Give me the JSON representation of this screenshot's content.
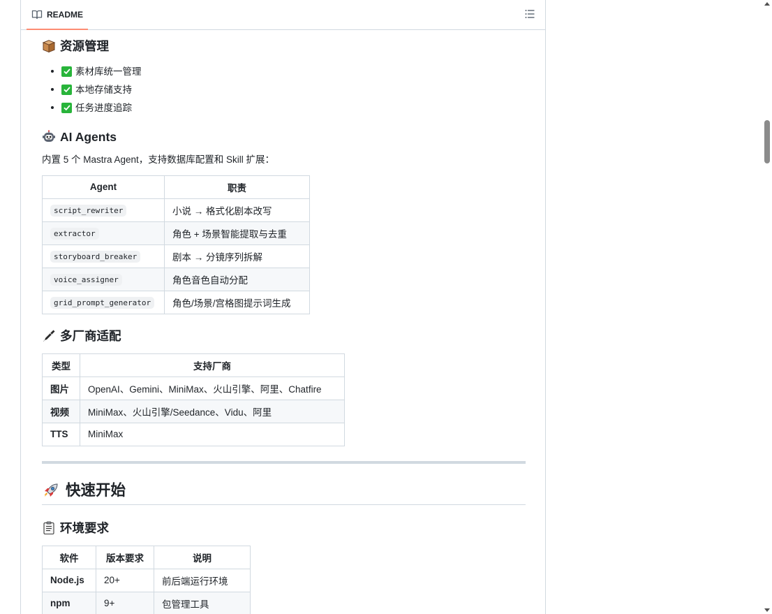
{
  "readme_tab": {
    "label": "README",
    "icon": "book-icon"
  },
  "outline_button": {
    "icon": "list-unordered-icon"
  },
  "resource_section": {
    "emoji": "package-emoji",
    "title": "资源管理",
    "items": [
      "素材库统一管理",
      "本地存储支持",
      "任务进度追踪"
    ]
  },
  "agents_section": {
    "emoji": "robot-emoji",
    "title": "AI Agents",
    "intro": "内置 5 个 Mastra Agent，支持数据库配置和 Skill 扩展：",
    "headers": [
      "Agent",
      "职责"
    ],
    "rows": [
      {
        "agent": "script_rewriter",
        "duty": "小说 → 格式化剧本改写"
      },
      {
        "agent": "extractor",
        "duty": "角色 + 场景智能提取与去重"
      },
      {
        "agent": "storyboard_breaker",
        "duty": "剧本 → 分镜序列拆解"
      },
      {
        "agent": "voice_assigner",
        "duty": "角色音色自动分配"
      },
      {
        "agent": "grid_prompt_generator",
        "duty": "角色/场景/宫格图提示词生成"
      }
    ]
  },
  "vendors_section": {
    "emoji": "pen-emoji",
    "title": "多厂商适配",
    "headers": [
      "类型",
      "支持厂商"
    ],
    "rows": [
      {
        "type": "图片",
        "vendors": "OpenAI、Gemini、MiniMax、火山引擎、阿里、Chatfire"
      },
      {
        "type": "视频",
        "vendors": "MiniMax、火山引擎/Seedance、Vidu、阿里"
      },
      {
        "type": "TTS",
        "vendors": "MiniMax"
      }
    ]
  },
  "quickstart": {
    "emoji": "rocket-emoji",
    "title": "快速开始"
  },
  "env_section": {
    "emoji": "clipboard-emoji",
    "title": "环境要求",
    "headers": [
      "软件",
      "版本要求",
      "说明"
    ],
    "rows": [
      {
        "software": "Node.js",
        "version": "20+",
        "desc": "前后端运行环境"
      },
      {
        "software": "npm",
        "version": "9+",
        "desc": "包管理工具"
      }
    ]
  }
}
